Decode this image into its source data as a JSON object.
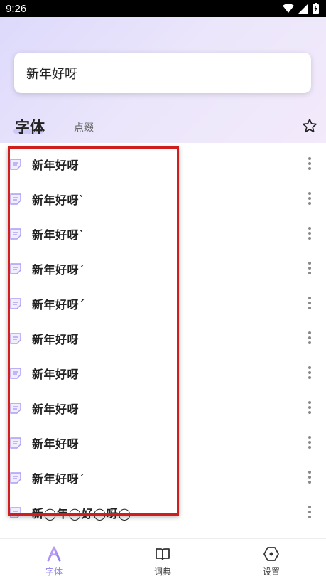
{
  "status_bar": {
    "time": "9:26"
  },
  "input": {
    "value": "新年好呀"
  },
  "tabs": {
    "font": "字体",
    "decor": "点缀"
  },
  "list_items": [
    "新年好呀",
    "新年好呀ˋ",
    "新年好呀ˋ",
    "新年好呀ˊ",
    "新年好呀ˊ",
    "新年好呀",
    "新年好呀",
    "新年好呀",
    "新年好呀",
    "新年好呀ˊ",
    "新◯年◯好◯呀◯"
  ],
  "bottom_nav": {
    "items": [
      {
        "label": "字体",
        "icon": "font-a-icon",
        "active": true
      },
      {
        "label": "词典",
        "icon": "book-icon",
        "active": false
      },
      {
        "label": "设置",
        "icon": "settings-hex-icon",
        "active": false
      }
    ]
  },
  "colors": {
    "accent": "#8a7ff0",
    "highlight": "#d01e1e"
  }
}
